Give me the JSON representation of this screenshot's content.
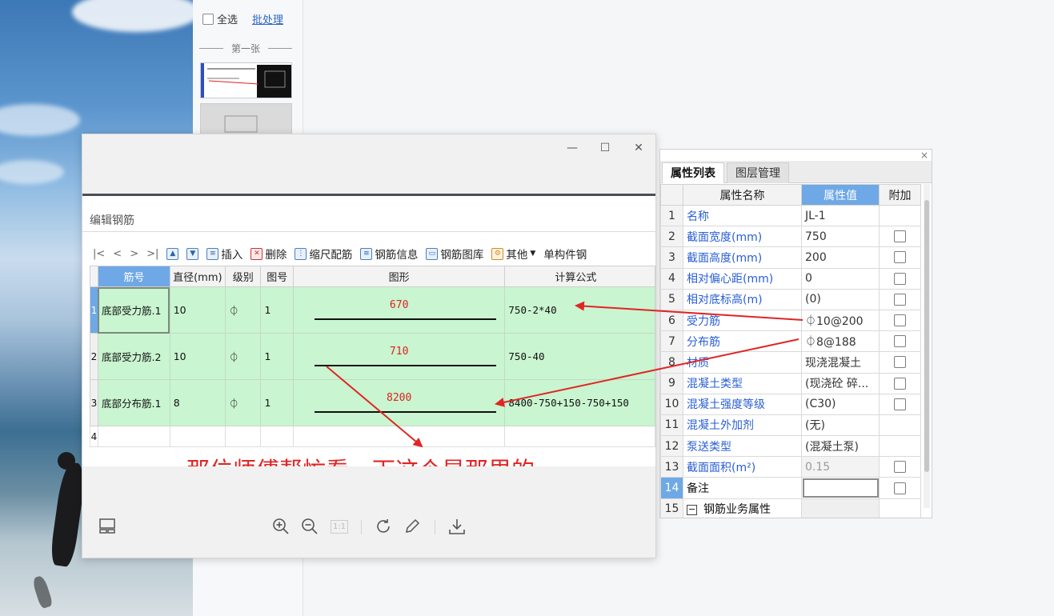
{
  "thumbnails": {
    "select_all_label": "全选",
    "batch_label": "批处理",
    "sheet_label": "第一张"
  },
  "viewer": {
    "window_buttons": {
      "minimize": "—",
      "maximize": "☐",
      "close": "✕"
    },
    "edit_title": "编辑钢筋",
    "toolbar": {
      "nav": [
        "|<",
        "<",
        ">",
        ">|"
      ],
      "insert": "插入",
      "delete": "删除",
      "scale_config": "缩尺配筋",
      "rebar_info": "钢筋信息",
      "rebar_library": "钢筋图库",
      "other": "其他",
      "single_component": "单构件钢"
    },
    "table": {
      "headers": [
        "筋号",
        "直径(mm)",
        "级别",
        "图号",
        "图形",
        "计算公式"
      ],
      "rows": [
        {
          "row": "1",
          "name": "底部受力筋.1",
          "diameter": "10",
          "grade": "⏀",
          "fig_no": "1",
          "shape_value": "670",
          "formula": "750-2*40"
        },
        {
          "row": "2",
          "name": "底部受力筋.2",
          "diameter": "10",
          "grade": "⏀",
          "fig_no": "1",
          "shape_value": "710",
          "formula": "750-40"
        },
        {
          "row": "3",
          "name": "底部分布筋.1",
          "diameter": "8",
          "grade": "⏀",
          "fig_no": "1",
          "shape_value": "8200",
          "formula": "8400-750+150-750+150"
        }
      ],
      "empty_row": "4"
    },
    "caption": "那位师傅帮忙看一下这个是那里的",
    "bottom_icons": [
      "layout-icon",
      "zoom-in-icon",
      "zoom-out-icon",
      "actual-size-icon",
      "rotate-icon",
      "edit-icon",
      "download-icon"
    ],
    "actual_size_label": "1:1"
  },
  "properties": {
    "close": "×",
    "tabs": [
      "属性列表",
      "图层管理"
    ],
    "headers": [
      "属性名称",
      "属性值",
      "附加"
    ],
    "rows": [
      {
        "n": "1",
        "name": "名称",
        "value": "JL-1",
        "check": false
      },
      {
        "n": "2",
        "name": "截面宽度(mm)",
        "value": "750",
        "check": true
      },
      {
        "n": "3",
        "name": "截面高度(mm)",
        "value": "200",
        "check": true
      },
      {
        "n": "4",
        "name": "相对偏心距(mm)",
        "value": "0",
        "check": true
      },
      {
        "n": "5",
        "name": "相对底标高(m)",
        "value": "(0)",
        "check": true
      },
      {
        "n": "6",
        "name": "受力筋",
        "value": "⏀10@200",
        "check": true
      },
      {
        "n": "7",
        "name": "分布筋",
        "value": "⏀8@188",
        "check": true
      },
      {
        "n": "8",
        "name": "材质",
        "value": "现浇混凝土",
        "check": true
      },
      {
        "n": "9",
        "name": "混凝土类型",
        "value": "(现浇砼 碎...",
        "check": true
      },
      {
        "n": "10",
        "name": "混凝土强度等级",
        "value": "(C30)",
        "check": true
      },
      {
        "n": "11",
        "name": "混凝土外加剂",
        "value": "(无)",
        "check": false
      },
      {
        "n": "12",
        "name": "泵送类型",
        "value": "(混凝土泵)",
        "check": false
      },
      {
        "n": "13",
        "name": "截面面积(m²)",
        "value": "0.15",
        "check": true
      },
      {
        "n": "14",
        "name": "备注",
        "value": "",
        "check": true
      },
      {
        "n": "15",
        "name": "钢筋业务属性",
        "value": "",
        "check": false
      }
    ]
  },
  "colors": {
    "accent_blue": "#6fa8e6",
    "row_green": "#c9f5d0",
    "annotation_red": "#e02525",
    "link_blue": "#2a5fd4"
  }
}
